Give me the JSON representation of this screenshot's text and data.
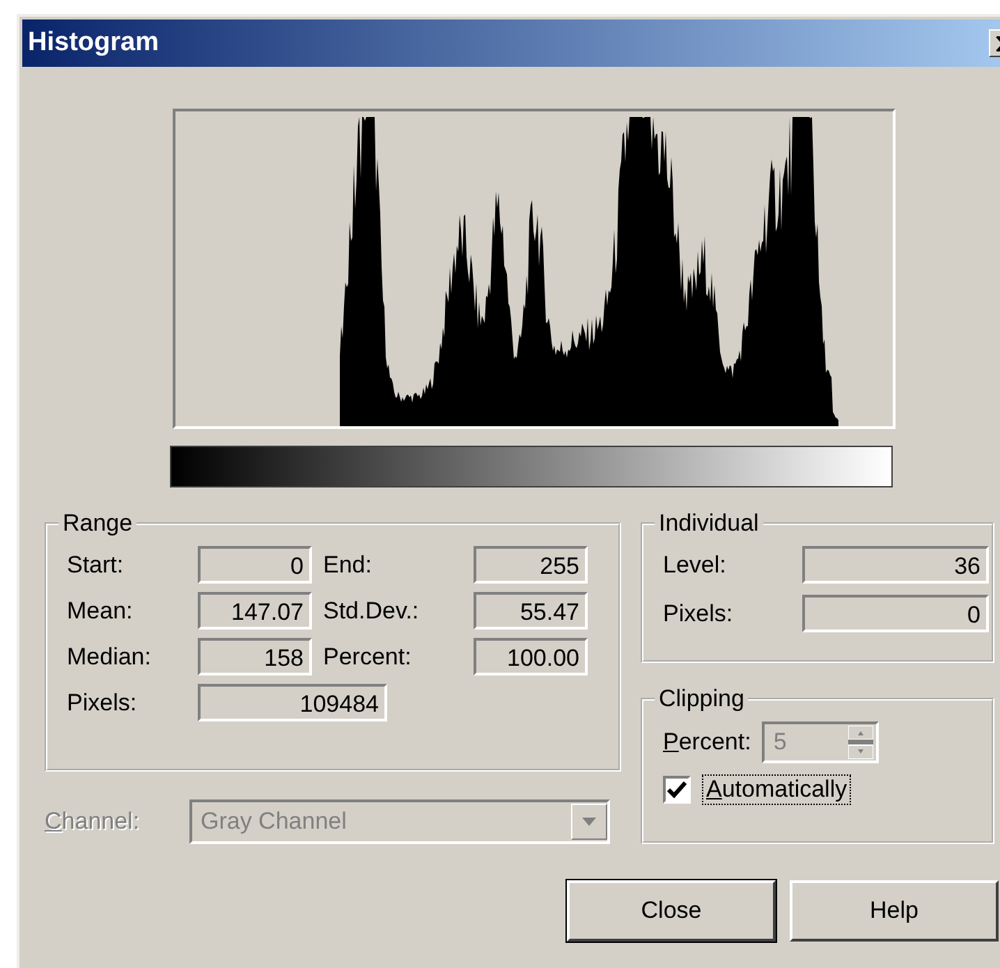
{
  "window": {
    "title": "Histogram"
  },
  "range": {
    "title": "Range",
    "fields": [
      {
        "label": "Start:",
        "value": "0"
      },
      {
        "label": "End:",
        "value": "255"
      },
      {
        "label": "Mean:",
        "value": "147.07"
      },
      {
        "label": "Std.Dev.:",
        "value": "55.47"
      },
      {
        "label": "Median:",
        "value": "158"
      },
      {
        "label": "Percent:",
        "value": "100.00"
      }
    ],
    "pixels": {
      "label": "Pixels:",
      "value": "109484"
    }
  },
  "individual": {
    "title": "Individual",
    "fields": [
      {
        "label": "Level:",
        "value": "36"
      },
      {
        "label": "Pixels:",
        "value": "0"
      }
    ]
  },
  "clipping": {
    "title": "Clipping",
    "percent": {
      "label": "Percent:",
      "value": "5",
      "disabled": true
    },
    "automatically": {
      "label": "Automatically",
      "checked": true
    }
  },
  "channel": {
    "label": "Channel:",
    "value": "Gray Channel",
    "disabled": true
  },
  "buttons": [
    "Close",
    "Help"
  ]
}
